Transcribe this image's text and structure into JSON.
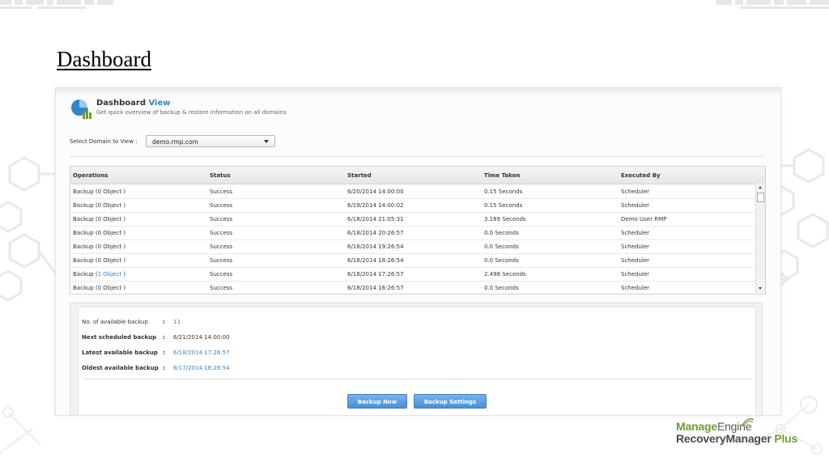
{
  "slide": {
    "title": "Dashboard"
  },
  "header": {
    "title": "Dashboard",
    "title_accent": "View",
    "subtitle": "Get quick overview of backup & restore information on all domains"
  },
  "domain": {
    "label": "Select Domain to View :",
    "selected": "demo.rmp.com"
  },
  "table": {
    "headers": [
      "Operations",
      "Status",
      "Started",
      "Time Taken",
      "Executed By"
    ],
    "rows": [
      {
        "op_prefix": "Backup (",
        "op_count": "0 Object",
        "op_suffix": " )",
        "status": "Success",
        "started": "6/20/2014 14:00:00",
        "time": "0.15 Seconds",
        "by": "Scheduler"
      },
      {
        "op_prefix": "Backup (",
        "op_count": "0 Object",
        "op_suffix": " )",
        "status": "Success",
        "started": "6/19/2014 14:00:02",
        "time": "0.15 Seconds",
        "by": "Scheduler"
      },
      {
        "op_prefix": "Backup (",
        "op_count": "0 Object",
        "op_suffix": " )",
        "status": "Success",
        "started": "6/18/2014 21:05:31",
        "time": "3.189 Seconds",
        "by": "Demo User RMP"
      },
      {
        "op_prefix": "Backup (",
        "op_count": "0 Object",
        "op_suffix": " )",
        "status": "Success",
        "started": "6/18/2014 20:26:57",
        "time": "0.0 Seconds",
        "by": "Scheduler"
      },
      {
        "op_prefix": "Backup (",
        "op_count": "0 Object",
        "op_suffix": " )",
        "status": "Success",
        "started": "6/18/2014 19:26:54",
        "time": "0.0 Seconds",
        "by": "Scheduler"
      },
      {
        "op_prefix": "Backup (",
        "op_count": "0 Object",
        "op_suffix": " )",
        "status": "Success",
        "started": "6/18/2014 18:26:54",
        "time": "0.0 Seconds",
        "by": "Scheduler"
      },
      {
        "op_prefix": "Backup (",
        "op_count": "1 Object",
        "op_suffix": " )",
        "status": "Success",
        "started": "6/18/2014 17:26:57",
        "time": "2.498 Seconds",
        "by": "Scheduler"
      },
      {
        "op_prefix": "Backup (",
        "op_count": "0 Object",
        "op_suffix": " )",
        "status": "Success",
        "started": "6/18/2014 16:26:57",
        "time": "0.0 Seconds",
        "by": "Scheduler"
      }
    ]
  },
  "summary": {
    "available_label": "No. of available backup",
    "available_value": "13",
    "next_label": "Next scheduled backup",
    "next_value": "6/21/2014 14:00:00",
    "latest_label": "Latest available backup",
    "latest_value": "6/18/2014 17:26:57",
    "oldest_label": "Oldest available backup",
    "oldest_value": "6/17/2014 18:26:54",
    "colon": ":"
  },
  "buttons": {
    "backup_now": "Backup Now",
    "backup_settings": "Backup Settings"
  },
  "brand": {
    "top_bold": "Manage",
    "top_light": "Engine",
    "bottom": "RecoveryManager",
    "plus": "Plus"
  },
  "colors": {
    "accent": "#2e86c9",
    "button": "#5b9be0",
    "brand_green": "#6e9e2f"
  },
  "icons": {
    "dashboard": "pie-chart-bars-icon",
    "dropdown": "chevron-down-icon"
  }
}
